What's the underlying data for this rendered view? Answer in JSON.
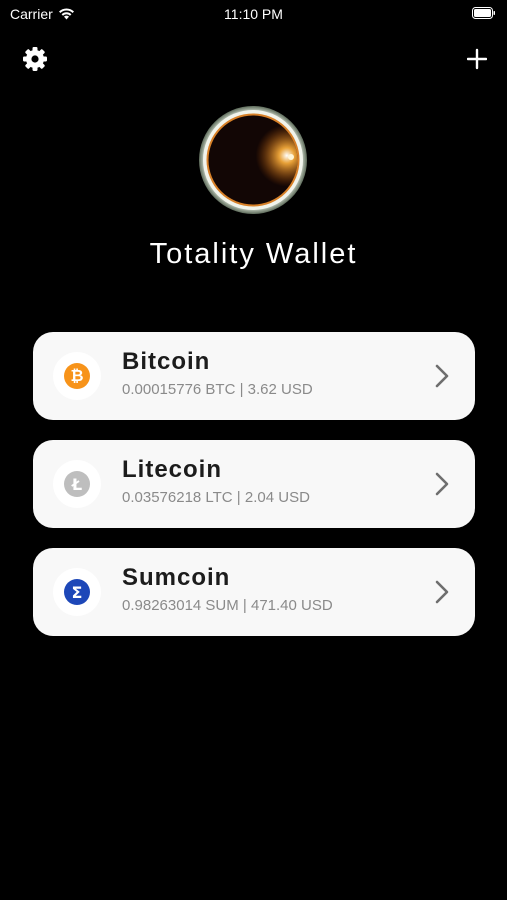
{
  "status_bar": {
    "carrier": "Carrier",
    "time": "11:10 PM"
  },
  "header": {
    "settings_icon": "gear-icon",
    "add_icon": "plus-icon"
  },
  "wallet": {
    "title": "Totality Wallet"
  },
  "coins": [
    {
      "name": "Bitcoin",
      "balance": "0.00015776 BTC | 3.62 USD",
      "icon": "bitcoin-icon",
      "symbol": "₿",
      "color": "#f7931a"
    },
    {
      "name": "Litecoin",
      "balance": "0.03576218 LTC | 2.04 USD",
      "icon": "litecoin-icon",
      "symbol": "Ł",
      "color": "#bebebe"
    },
    {
      "name": "Sumcoin",
      "balance": "0.98263014 SUM | 471.40 USD",
      "icon": "sumcoin-icon",
      "symbol": "Σ",
      "color": "#1d47b8"
    }
  ],
  "colors": {
    "background": "#000000",
    "card": "#f8f8f8",
    "title_text": "#1c1c1c",
    "subtitle_text": "#8a8a8a"
  }
}
